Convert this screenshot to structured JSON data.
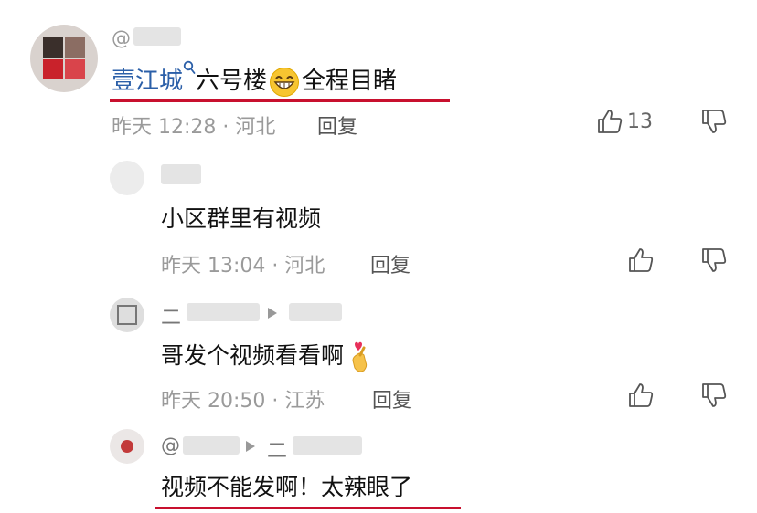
{
  "comments": [
    {
      "handle": "@",
      "text_topic": "壹江城",
      "text_rest": "六号楼",
      "text_tail": "全程目睹",
      "time": "昨天 12:28 · 河北",
      "reply_label": "回复",
      "like_count": "13"
    },
    {
      "text": "小区群里有视频",
      "time": "昨天 13:04 · 河北",
      "reply_label": "回复"
    },
    {
      "name_prefix": "二",
      "text": "哥发个视频看看啊",
      "time": "昨天 20:50 · 江苏",
      "reply_label": "回复"
    },
    {
      "handle": "@",
      "name_fragment": "二",
      "text": "视频不能发啊！太辣眼了"
    }
  ],
  "colors": {
    "topic": "#2b5fa8",
    "underline": "#c8102e",
    "meta": "#9a9a9a"
  }
}
